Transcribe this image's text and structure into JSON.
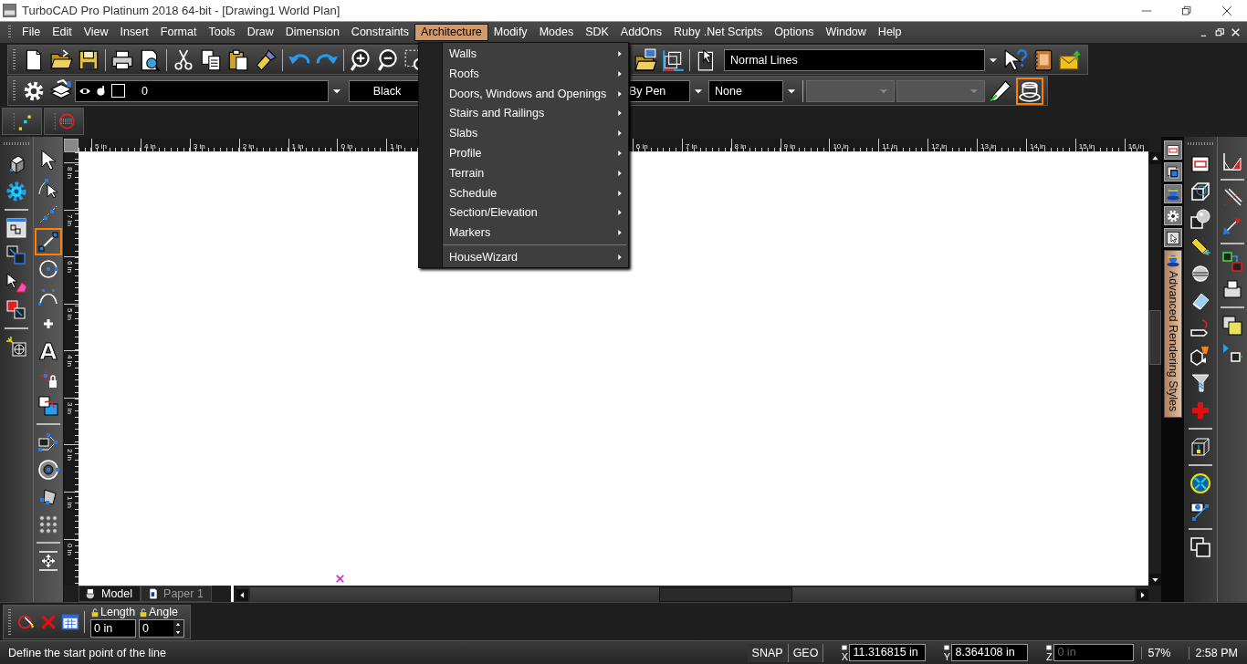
{
  "window": {
    "title": "TurboCAD Pro Platinum 2018 64-bit - [Drawing1 World Plan]"
  },
  "menu_bar": [
    {
      "label": "File",
      "selected": false
    },
    {
      "label": "Edit",
      "selected": false
    },
    {
      "label": "View",
      "selected": false
    },
    {
      "label": "Insert",
      "selected": false
    },
    {
      "label": "Format",
      "selected": false
    },
    {
      "label": "Tools",
      "selected": false
    },
    {
      "label": "Draw",
      "selected": false
    },
    {
      "label": "Dimension",
      "selected": false
    },
    {
      "label": "Constraints",
      "selected": false
    },
    {
      "label": "Architecture",
      "selected": true
    },
    {
      "label": "Modify",
      "selected": false
    },
    {
      "label": "Modes",
      "selected": false
    },
    {
      "label": "SDK",
      "selected": false
    },
    {
      "label": "AddOns",
      "selected": false
    },
    {
      "label": "Ruby .Net Scripts",
      "selected": false
    },
    {
      "label": "Options",
      "selected": false
    },
    {
      "label": "Window",
      "selected": false
    },
    {
      "label": "Help",
      "selected": false
    }
  ],
  "architecture_menu": {
    "items": [
      {
        "kind": "submenu",
        "label": "Walls"
      },
      {
        "kind": "submenu",
        "label": "Roofs"
      },
      {
        "kind": "submenu",
        "label": "Doors, Windows and Openings"
      },
      {
        "kind": "submenu",
        "label": "Stairs and Railings"
      },
      {
        "kind": "submenu",
        "label": "Slabs"
      },
      {
        "kind": "submenu",
        "label": "Profile"
      },
      {
        "kind": "submenu",
        "label": "Terrain"
      },
      {
        "kind": "submenu",
        "label": "Schedule"
      },
      {
        "kind": "submenu",
        "label": "Section/Elevation"
      },
      {
        "kind": "submenu",
        "label": "Markers"
      },
      {
        "kind": "separator"
      },
      {
        "kind": "submenu",
        "label": "HouseWizard"
      }
    ]
  },
  "toolbar": {
    "style_field": "Normal Lines",
    "layer_field": "0",
    "color_field": "Black",
    "pen_field": "By Pen",
    "fill_field": "None",
    "render_style_button": {
      "selected": true
    }
  },
  "draw_tools": [
    {
      "selected": false
    },
    {
      "selected": false
    },
    {
      "selected": false
    },
    {
      "selected": true
    },
    {
      "selected": false
    },
    {
      "selected": false
    },
    {
      "selected": false
    },
    {
      "selected": false,
      "glyph": "A"
    },
    {
      "selected": false
    },
    {
      "selected": false
    },
    {
      "selected": false
    },
    {
      "selected": false
    },
    {
      "selected": false
    },
    {
      "selected": false
    },
    {
      "selected": false
    }
  ],
  "ruler": {
    "top_left": [
      "5 in",
      "4 in",
      "3 in",
      "2 in",
      "1 in",
      "0 in",
      "1 in"
    ],
    "top_right": [
      "6 in",
      "7 in",
      "8 in",
      "9 in",
      "10 in",
      "11 in",
      "12 in",
      "13 in",
      "14 in",
      "15 in",
      "16 in"
    ],
    "left": [
      "8 in",
      "7 in",
      "6 in",
      "5 in",
      "4 in",
      "3 in",
      "2 in",
      "1 in",
      "0 in"
    ]
  },
  "canvas_tabs": [
    {
      "label": "Model",
      "selected": true
    },
    {
      "label": "Paper 1",
      "selected": false
    }
  ],
  "side_tab": {
    "label": "Advanced Rendering Styles"
  },
  "inspector": {
    "length": {
      "label": "Length",
      "value": "0 in"
    },
    "angle": {
      "label": "Angle",
      "value": "0"
    }
  },
  "status_bar": {
    "prompt": "Define the start point of the line",
    "snap": "SNAP",
    "geo": "GEO",
    "x": {
      "label": "X",
      "value": "11.316815 in",
      "disabled": false
    },
    "y": {
      "label": "Y",
      "value": "8.364108 in",
      "disabled": false
    },
    "z": {
      "label": "Z",
      "value": "0 in",
      "disabled": true
    },
    "zoom": "57%",
    "time": "2:58 PM"
  }
}
